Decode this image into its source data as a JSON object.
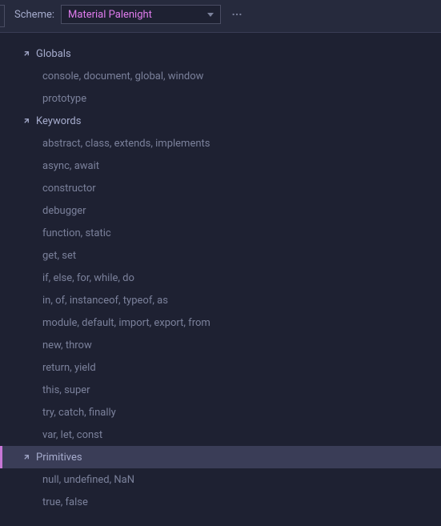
{
  "toolbar": {
    "scheme_label": "Scheme:",
    "scheme_value": "Material Palenight"
  },
  "tree": {
    "groups": [
      {
        "name": "Globals",
        "expanded": true,
        "selected": false,
        "items": [
          "console, document, global, window",
          "prototype"
        ]
      },
      {
        "name": "Keywords",
        "expanded": true,
        "selected": false,
        "items": [
          "abstract, class, extends, implements",
          "async, await",
          "constructor",
          "debugger",
          "function, static",
          "get, set",
          "if, else, for, while, do",
          "in, of, instanceof, typeof, as",
          "module, default, import, export, from",
          "new, throw",
          "return, yield",
          "this, super",
          "try, catch, finally",
          "var, let, const"
        ]
      },
      {
        "name": "Primitives",
        "expanded": true,
        "selected": true,
        "items": [
          "null, undefined, NaN",
          "true, false"
        ]
      }
    ]
  }
}
